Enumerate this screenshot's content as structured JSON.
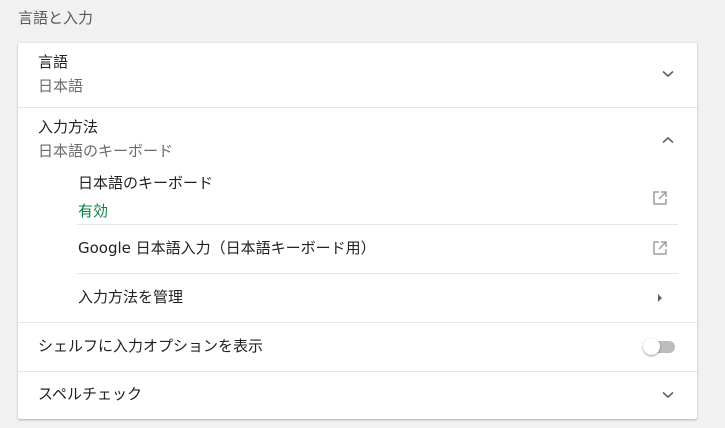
{
  "section": {
    "title": "言語と入力"
  },
  "language": {
    "label": "言語",
    "value": "日本語"
  },
  "input_method": {
    "label": "入力方法",
    "value": "日本語のキーボード",
    "items": [
      {
        "label": "日本語のキーボード",
        "status": "有効"
      },
      {
        "label": "Google 日本語入力（日本語キーボード用）"
      }
    ],
    "manage_label": "入力方法を管理"
  },
  "shelf_option": {
    "label": "シェルフに入力オプションを表示",
    "enabled": false
  },
  "spellcheck": {
    "label": "スペルチェック"
  },
  "colors": {
    "enabled_status": "#0b8043",
    "toggle_off_track": "#bdbdbd"
  }
}
